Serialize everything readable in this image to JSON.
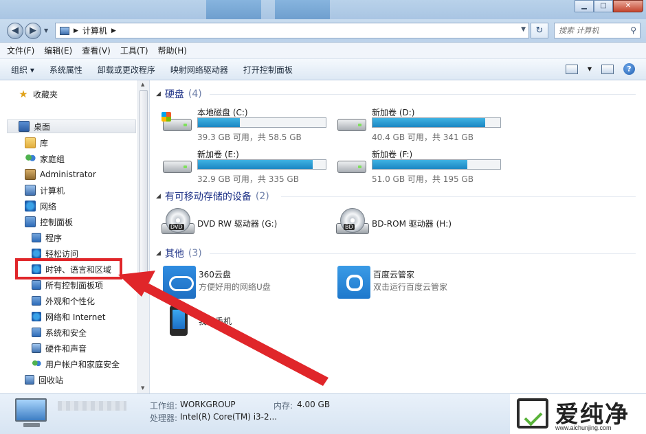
{
  "window": {
    "min_label": "▁",
    "max_label": "□",
    "close_label": "✕"
  },
  "address": {
    "path": "计算机",
    "search_placeholder": "搜索 计算机"
  },
  "menubar": [
    "文件(F)",
    "编辑(E)",
    "查看(V)",
    "工具(T)",
    "帮助(H)"
  ],
  "commands": [
    "组织 ▾",
    "系统属性",
    "卸载或更改程序",
    "映射网络驱动器",
    "打开控制面板"
  ],
  "nav": {
    "favorites": "收藏夹",
    "desktop": "桌面",
    "library": "库",
    "homegroup": "家庭组",
    "user": "Administrator",
    "computer": "计算机",
    "network": "网络",
    "control_panel": "控制面板",
    "cp_items": [
      "程序",
      "轻松访问",
      "时钟、语言和区域",
      "所有控制面板项",
      "外观和个性化",
      "网络和 Internet",
      "系统和安全",
      "硬件和声音",
      "用户帐户和家庭安全"
    ],
    "recycle": "回收站"
  },
  "groups": {
    "hdd": {
      "title": "硬盘",
      "count": "(4)"
    },
    "removable": {
      "title": "有可移动存储的设备",
      "count": "(2)"
    },
    "other": {
      "title": "其他",
      "count": "(3)"
    }
  },
  "drives": [
    {
      "name": "本地磁盘 (C:)",
      "info": "39.3 GB 可用，共 58.5 GB",
      "used_fraction": 0.33,
      "system": true
    },
    {
      "name": "新加卷 (D:)",
      "info": "40.4 GB 可用，共 341 GB",
      "used_fraction": 0.88,
      "system": false
    },
    {
      "name": "新加卷 (E:)",
      "info": "32.9 GB 可用，共 335 GB",
      "used_fraction": 0.9,
      "system": false
    },
    {
      "name": "新加卷 (F:)",
      "info": "51.0 GB 可用，共 195 GB",
      "used_fraction": 0.74,
      "system": false
    }
  ],
  "removable": [
    {
      "name": "DVD RW 驱动器 (G:)",
      "badge": "DVD"
    },
    {
      "name": "BD-ROM 驱动器 (H:)",
      "badge": "BD"
    }
  ],
  "others": [
    {
      "name": "360云盘",
      "desc": "方便好用的网络U盘",
      "icon": "cloud-360-icon"
    },
    {
      "name": "百度云管家",
      "desc": "双击运行百度云管家",
      "icon": "baidu-cloud-icon"
    },
    {
      "name": "我的手机",
      "desc": "",
      "icon": "phone-icon"
    }
  ],
  "details": {
    "workgroup_label": "工作组:",
    "workgroup_value": "WORKGROUP",
    "memory_label": "内存:",
    "memory_value": "4.00 GB",
    "cpu_label": "处理器:",
    "cpu_value": "Intel(R) Core(TM) i3-2..."
  },
  "watermark": {
    "text": "爱纯净",
    "url": "www.aichunjing.com"
  },
  "colors": {
    "highlight": "#e0262a",
    "drive_bar": "#1b86c3"
  }
}
